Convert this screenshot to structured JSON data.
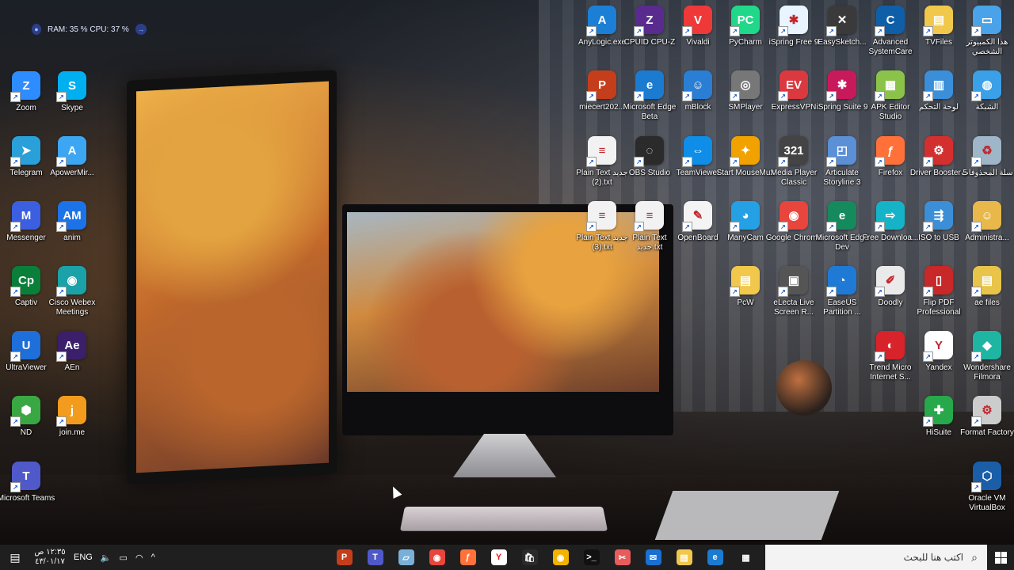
{
  "system_monitor": {
    "text": "RAM: 35 %  CPU: 37 %"
  },
  "desktop_icons": [
    {
      "id": "zoom",
      "label": "Zoom",
      "bg": "#2d8cff",
      "glyph": "Z"
    },
    {
      "id": "skype",
      "label": "Skype",
      "bg": "#00aff0",
      "glyph": "S"
    },
    {
      "id": "telegram",
      "label": "Telegram",
      "bg": "#2aa0da",
      "glyph": "➤"
    },
    {
      "id": "apowermirror",
      "label": "ApowerMir...",
      "bg": "#3da6f2",
      "glyph": "A"
    },
    {
      "id": "messenger",
      "label": "Messenger",
      "bg": "#3b5fe0",
      "glyph": "M"
    },
    {
      "id": "anim",
      "label": "anim",
      "bg": "#1c73e8",
      "glyph": "AM"
    },
    {
      "id": "captiv",
      "label": "Captiv",
      "bg": "#0a7f3a",
      "glyph": "Cp"
    },
    {
      "id": "webex",
      "label": "Cisco Webex Meetings",
      "bg": "#1aa2a8",
      "glyph": "◉"
    },
    {
      "id": "ultraviewer",
      "label": "UltraViewer",
      "bg": "#1e6fd9",
      "glyph": "U"
    },
    {
      "id": "aen",
      "label": "AEn",
      "bg": "#3b1f6b",
      "glyph": "Ae"
    },
    {
      "id": "nd",
      "label": "ND",
      "bg": "#3aa842",
      "glyph": "⬢"
    },
    {
      "id": "joinme",
      "label": "join.me",
      "bg": "#f29b1d",
      "glyph": "j"
    },
    {
      "id": "teams",
      "label": "Microsoft Teams",
      "bg": "#5059c9",
      "glyph": "T"
    },
    {
      "id": "anylogic",
      "label": "AnyLogic.exe",
      "bg": "#1c7fd6",
      "glyph": "A"
    },
    {
      "id": "cpuz",
      "label": "CPUID CPU-Z",
      "bg": "#5a2b8f",
      "glyph": "Z"
    },
    {
      "id": "vivaldi",
      "label": "Vivaldi",
      "bg": "#ef3939",
      "glyph": "V"
    },
    {
      "id": "pycharm",
      "label": "PyCharm",
      "bg": "#21d789",
      "glyph": "PC"
    },
    {
      "id": "ispring9a",
      "label": "iSpring Free 9",
      "bg": "#e8f4ff",
      "glyph": "✱"
    },
    {
      "id": "easysketch",
      "label": "EasySketch...",
      "bg": "#3a3a3a",
      "glyph": "✕"
    },
    {
      "id": "asc",
      "label": "Advanced SystemCare",
      "bg": "#0e5fa8",
      "glyph": "C"
    },
    {
      "id": "tvfiles",
      "label": "TVFiles",
      "bg": "#f1c84b",
      "glyph": "▤"
    },
    {
      "id": "thispc",
      "label": "هذا الكمبيوتر الشخصي",
      "bg": "#4aa3e8",
      "glyph": "▭"
    },
    {
      "id": "miecert",
      "label": "miecert202...",
      "bg": "#c43e1c",
      "glyph": "P"
    },
    {
      "id": "edgebeta",
      "label": "Microsoft Edge Beta",
      "bg": "#1a7bd0",
      "glyph": "e"
    },
    {
      "id": "mblock",
      "label": "mBlock",
      "bg": "#2a7fd4",
      "glyph": "☺"
    },
    {
      "id": "smplayer",
      "label": "SMPlayer",
      "bg": "#777777",
      "glyph": "◎"
    },
    {
      "id": "expressvpn",
      "label": "ExpressVPN",
      "bg": "#da3940",
      "glyph": "EV"
    },
    {
      "id": "ispringsuite",
      "label": "iSpring Suite 9",
      "bg": "#c81a5a",
      "glyph": "✱"
    },
    {
      "id": "apkeditor",
      "label": "APK Editor Studio",
      "bg": "#8bc34a",
      "glyph": "▦"
    },
    {
      "id": "controlpanel",
      "label": "لوحة التحكم",
      "bg": "#3b8fd9",
      "glyph": "▥"
    },
    {
      "id": "network",
      "label": "الشبكة",
      "bg": "#3aa0e8",
      "glyph": "◍"
    },
    {
      "id": "plaintext2",
      "label": "Plain Text جديد (2).txt",
      "bg": "#f2f2f2",
      "glyph": "≡"
    },
    {
      "id": "obs",
      "label": "OBS Studio",
      "bg": "#2b2b2b",
      "glyph": "◌"
    },
    {
      "id": "teamviewer",
      "label": "TeamViewer",
      "bg": "#0e8ee9",
      "glyph": "⇔"
    },
    {
      "id": "mousemux",
      "label": "Start MouseMux",
      "bg": "#f2a200",
      "glyph": "✦"
    },
    {
      "id": "mpc",
      "label": "Media Player Classic",
      "bg": "#444444",
      "glyph": "321"
    },
    {
      "id": "storyline",
      "label": "Articulate Storyline 3",
      "bg": "#5b8fd6",
      "glyph": "◰"
    },
    {
      "id": "firefox",
      "label": "Firefox",
      "bg": "#ff7139",
      "glyph": "ƒ"
    },
    {
      "id": "driverbooster",
      "label": "Driver Booster 5",
      "bg": "#d32f2f",
      "glyph": "⚙"
    },
    {
      "id": "recyclebin",
      "label": "سلة المحذوفات",
      "bg": "#9fb5c8",
      "glyph": "♻"
    },
    {
      "id": "plaintext3",
      "label": "Plain Text جديد (3).txt",
      "bg": "#f2f2f2",
      "glyph": "≡"
    },
    {
      "id": "plaintext1",
      "label": "Plain Text جديد.txt",
      "bg": "#f2f2f2",
      "glyph": "≡"
    },
    {
      "id": "openboard",
      "label": "OpenBoard",
      "bg": "#f4f4f4",
      "glyph": "✎"
    },
    {
      "id": "manycam",
      "label": "ManyCam",
      "bg": "#25a0e4",
      "glyph": "◕"
    },
    {
      "id": "chrome",
      "label": "Google Chrome",
      "bg": "#e8453c",
      "glyph": "◉"
    },
    {
      "id": "edgedev",
      "label": "Microsoft Edge Dev",
      "bg": "#158a5c",
      "glyph": "e"
    },
    {
      "id": "freedownload",
      "label": "Free Downloa...",
      "bg": "#15b3c7",
      "glyph": "⇨"
    },
    {
      "id": "isotousb",
      "label": "ISO to USB",
      "bg": "#3c8fd6",
      "glyph": "⇶"
    },
    {
      "id": "administrator",
      "label": "Administra...",
      "bg": "#e8b84a",
      "glyph": "☺"
    },
    {
      "id": "pcw",
      "label": "PcW",
      "bg": "#f1c84b",
      "glyph": "▤"
    },
    {
      "id": "electa",
      "label": "eLecta Live Screen R...",
      "bg": "#555555",
      "glyph": "▣"
    },
    {
      "id": "easeus",
      "label": "EaseUS Partition ...",
      "bg": "#1f7ad6",
      "glyph": "◔"
    },
    {
      "id": "doodly",
      "label": "Doodly",
      "bg": "#eaeaea",
      "glyph": "✐"
    },
    {
      "id": "flippdf",
      "label": "Flip PDF Professional",
      "bg": "#c82828",
      "glyph": "▯"
    },
    {
      "id": "aefiles",
      "label": "ae files",
      "bg": "#e8c44a",
      "glyph": "▤"
    },
    {
      "id": "trendmicro",
      "label": "Trend Micro Internet S...",
      "bg": "#d8232a",
      "glyph": "◐"
    },
    {
      "id": "yandex",
      "label": "Yandex",
      "bg": "#ffffff",
      "glyph": "Y"
    },
    {
      "id": "filmora",
      "label": "Wondershare Filmora",
      "bg": "#1fb5a3",
      "glyph": "◆"
    },
    {
      "id": "hisuite",
      "label": "HiSuite",
      "bg": "#27a84a",
      "glyph": "✚"
    },
    {
      "id": "formatfactory",
      "label": "Format Factory",
      "bg": "#cccccc",
      "glyph": "⚙"
    },
    {
      "id": "virtualbox",
      "label": "Oracle VM VirtualBox",
      "bg": "#1b5ea8",
      "glyph": "⬡"
    }
  ],
  "taskbar": {
    "clock_time": "١٢:٣٥ ص",
    "clock_date": "٤٣/٠١/١٧",
    "language": "ENG",
    "search_placeholder": "اكتب هنا للبحث",
    "pinned": [
      {
        "id": "powerpoint",
        "bg": "#c43e1c",
        "glyph": "P"
      },
      {
        "id": "teams",
        "bg": "#5059c9",
        "glyph": "T"
      },
      {
        "id": "notepad",
        "bg": "#7ab0d8",
        "glyph": "▱"
      },
      {
        "id": "chrome",
        "bg": "#e8453c",
        "glyph": "◉"
      },
      {
        "id": "firefox",
        "bg": "#ff7139",
        "glyph": "ƒ"
      },
      {
        "id": "yandex",
        "bg": "#ffffff",
        "glyph": "Y"
      },
      {
        "id": "store",
        "bg": "#2a2a2a",
        "glyph": "🛍"
      },
      {
        "id": "chrome-canary",
        "bg": "#f2b200",
        "glyph": "◉"
      },
      {
        "id": "terminal",
        "bg": "#111111",
        "glyph": ">_"
      },
      {
        "id": "snip",
        "bg": "#e85c5c",
        "glyph": "✂"
      },
      {
        "id": "mail",
        "bg": "#1a6fd0",
        "glyph": "✉"
      },
      {
        "id": "explorer",
        "bg": "#f1c84b",
        "glyph": "▤"
      },
      {
        "id": "edge",
        "bg": "#1a7bd0",
        "glyph": "e"
      },
      {
        "id": "taskview",
        "bg": "#1f1f1f",
        "glyph": "▦"
      }
    ]
  }
}
